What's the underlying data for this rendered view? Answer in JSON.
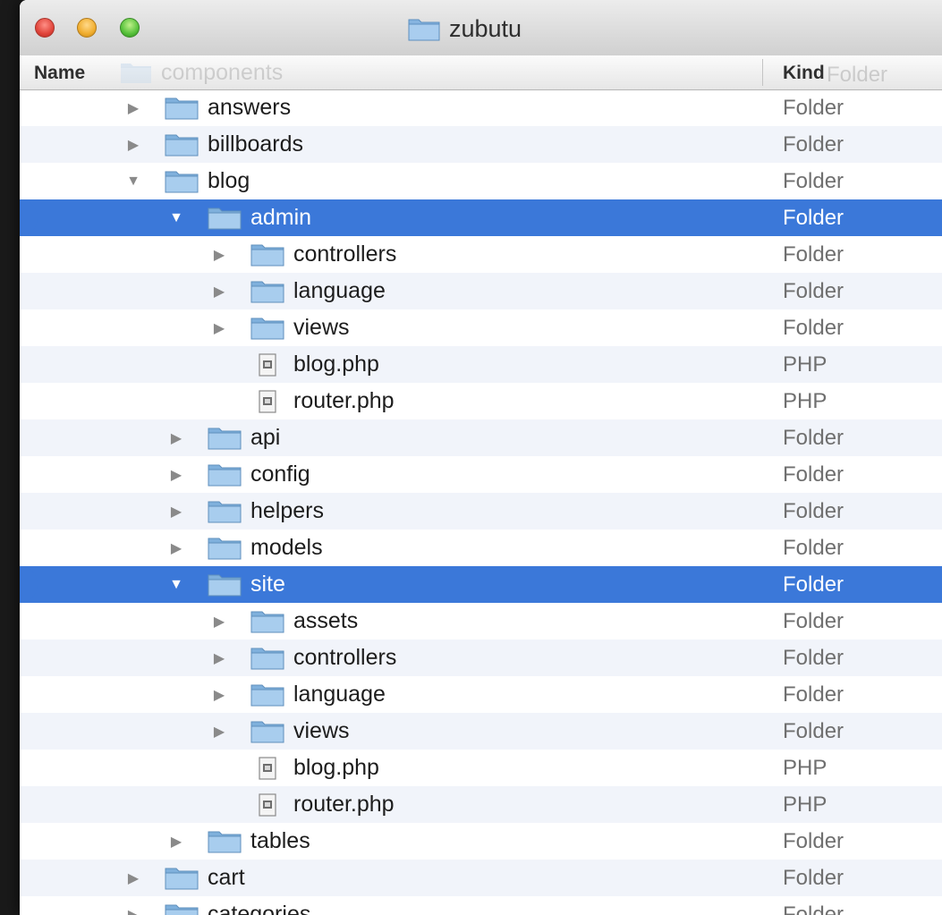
{
  "window": {
    "title": "zubutu",
    "title_icon": "folder-icon"
  },
  "columns": {
    "name_label": "Name",
    "kind_label": "Kind",
    "scrolled_under_name": "components",
    "scrolled_under_kind": "Folder"
  },
  "colors": {
    "selection": "#3b78d9",
    "folder": "#9cc3e6",
    "alt_row": "#f1f4fa"
  },
  "rows": [
    {
      "name": "answers",
      "kind": "Folder",
      "depth": 0,
      "type": "folder",
      "expanded": false,
      "selected": false
    },
    {
      "name": "billboards",
      "kind": "Folder",
      "depth": 0,
      "type": "folder",
      "expanded": false,
      "selected": false
    },
    {
      "name": "blog",
      "kind": "Folder",
      "depth": 0,
      "type": "folder",
      "expanded": true,
      "selected": false
    },
    {
      "name": "admin",
      "kind": "Folder",
      "depth": 1,
      "type": "folder",
      "expanded": true,
      "selected": true
    },
    {
      "name": "controllers",
      "kind": "Folder",
      "depth": 2,
      "type": "folder",
      "expanded": false,
      "selected": false
    },
    {
      "name": "language",
      "kind": "Folder",
      "depth": 2,
      "type": "folder",
      "expanded": false,
      "selected": false
    },
    {
      "name": "views",
      "kind": "Folder",
      "depth": 2,
      "type": "folder",
      "expanded": false,
      "selected": false
    },
    {
      "name": "blog.php",
      "kind": "PHP",
      "depth": 2,
      "type": "file",
      "expanded": false,
      "selected": false
    },
    {
      "name": "router.php",
      "kind": "PHP",
      "depth": 2,
      "type": "file",
      "expanded": false,
      "selected": false
    },
    {
      "name": "api",
      "kind": "Folder",
      "depth": 1,
      "type": "folder",
      "expanded": false,
      "selected": false
    },
    {
      "name": "config",
      "kind": "Folder",
      "depth": 1,
      "type": "folder",
      "expanded": false,
      "selected": false
    },
    {
      "name": "helpers",
      "kind": "Folder",
      "depth": 1,
      "type": "folder",
      "expanded": false,
      "selected": false
    },
    {
      "name": "models",
      "kind": "Folder",
      "depth": 1,
      "type": "folder",
      "expanded": false,
      "selected": false
    },
    {
      "name": "site",
      "kind": "Folder",
      "depth": 1,
      "type": "folder",
      "expanded": true,
      "selected": true
    },
    {
      "name": "assets",
      "kind": "Folder",
      "depth": 2,
      "type": "folder",
      "expanded": false,
      "selected": false
    },
    {
      "name": "controllers",
      "kind": "Folder",
      "depth": 2,
      "type": "folder",
      "expanded": false,
      "selected": false
    },
    {
      "name": "language",
      "kind": "Folder",
      "depth": 2,
      "type": "folder",
      "expanded": false,
      "selected": false
    },
    {
      "name": "views",
      "kind": "Folder",
      "depth": 2,
      "type": "folder",
      "expanded": false,
      "selected": false
    },
    {
      "name": "blog.php",
      "kind": "PHP",
      "depth": 2,
      "type": "file",
      "expanded": false,
      "selected": false
    },
    {
      "name": "router.php",
      "kind": "PHP",
      "depth": 2,
      "type": "file",
      "expanded": false,
      "selected": false
    },
    {
      "name": "tables",
      "kind": "Folder",
      "depth": 1,
      "type": "folder",
      "expanded": false,
      "selected": false
    },
    {
      "name": "cart",
      "kind": "Folder",
      "depth": 0,
      "type": "folder",
      "expanded": false,
      "selected": false
    },
    {
      "name": "categories",
      "kind": "Folder",
      "depth": 0,
      "type": "folder",
      "expanded": false,
      "selected": false
    }
  ]
}
